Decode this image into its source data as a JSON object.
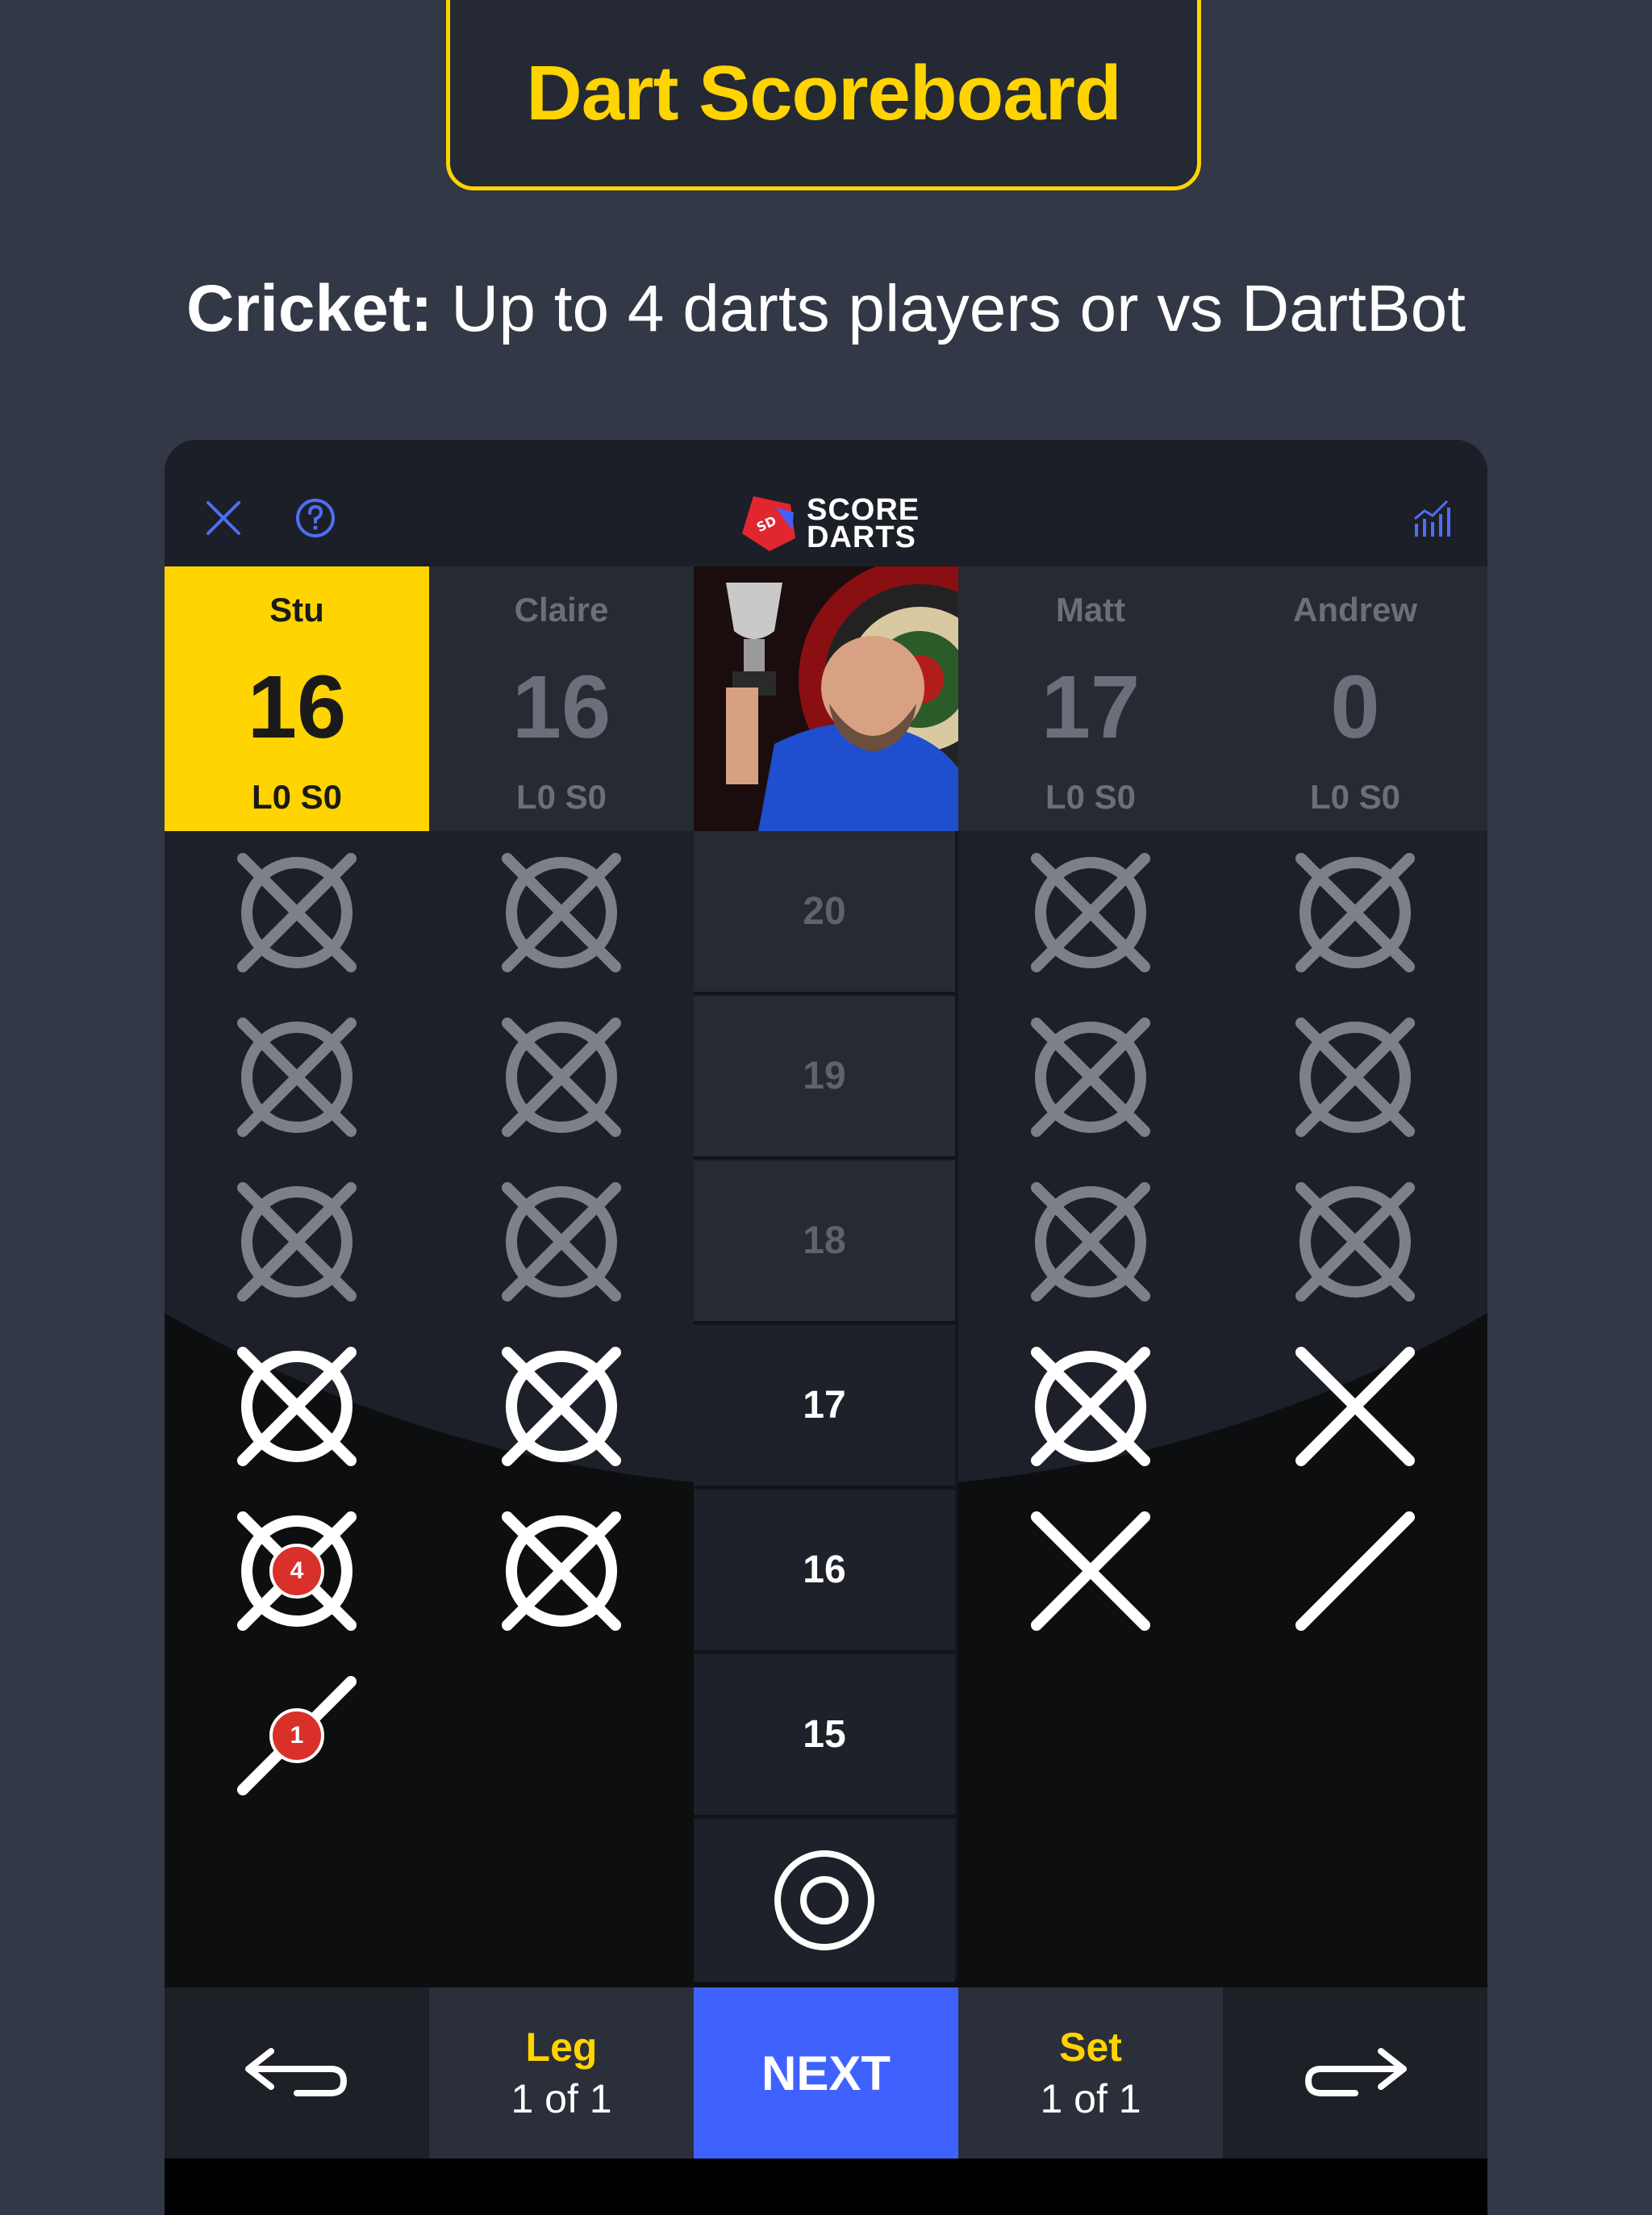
{
  "banner": {
    "title": "Dart Scoreboard",
    "subtitle_bold": "Cricket:",
    "subtitle_rest": " Up to 4 darts players or vs DartBot"
  },
  "app": {
    "header": {
      "close_icon": "close-icon",
      "help_icon": "help-icon",
      "logo_line1": "SCORE",
      "logo_line2": "DARTS",
      "stats_icon": "stats-icon"
    },
    "players": [
      {
        "name": "Stu",
        "score": "16",
        "stats": "L0 S0",
        "active": true
      },
      {
        "name": "Claire",
        "score": "16",
        "stats": "L0 S0",
        "active": false
      },
      {
        "name": "Matt",
        "score": "17",
        "stats": "L0 S0",
        "active": false
      },
      {
        "name": "Andrew",
        "score": "0",
        "stats": "L0 S0",
        "active": false
      }
    ],
    "targets": [
      "20",
      "19",
      "18",
      "17",
      "16",
      "15"
    ],
    "bull_icon": "bullseye-icon",
    "marks": {
      "Stu": [
        "closed",
        "closed",
        "closed",
        "closed",
        "closed",
        "single"
      ],
      "Claire": [
        "closed",
        "closed",
        "closed",
        "closed",
        "closed",
        "none"
      ],
      "Matt": [
        "closed",
        "closed",
        "closed",
        "closed",
        "double",
        "none"
      ],
      "Andrew": [
        "closed",
        "closed",
        "closed",
        "double",
        "single",
        "none"
      ]
    },
    "badges": {
      "stu_16": "4",
      "stu_15": "1"
    },
    "bottom": {
      "undo_icon": "undo-arrow-icon",
      "leg_label": "Leg",
      "leg_value": "1 of 1",
      "next_label": "NEXT",
      "set_label": "Set",
      "set_value": "1 of 1",
      "redo_icon": "redo-arrow-icon"
    },
    "colors": {
      "accent_yellow": "#ffd400",
      "next_blue": "#3f62ff",
      "badge_red": "#d9302a",
      "icon_blue": "#4f6df5"
    }
  }
}
